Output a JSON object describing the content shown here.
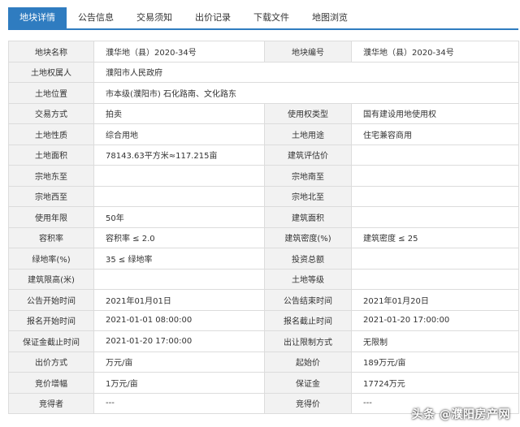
{
  "tabs": [
    {
      "label": "地块详情",
      "active": true
    },
    {
      "label": "公告信息"
    },
    {
      "label": "交易须知"
    },
    {
      "label": "出价记录"
    },
    {
      "label": "下载文件"
    },
    {
      "label": "地图浏览"
    }
  ],
  "rows": [
    [
      "地块名称",
      "濮华地（县）2020-34号",
      "地块编号",
      "濮华地（县）2020-34号"
    ],
    [
      "土地权属人",
      "濮阳市人民政府"
    ],
    [
      "土地位置",
      "市本级(濮阳市) 石化路南、文化路东"
    ],
    [
      "交易方式",
      "拍卖",
      "使用权类型",
      "国有建设用地使用权"
    ],
    [
      "土地性质",
      "综合用地",
      "土地用途",
      "住宅兼容商用"
    ],
    [
      "土地面积",
      "78143.63平方米≈117.215亩",
      "建筑评估价",
      ""
    ],
    [
      "宗地东至",
      "",
      "宗地南至",
      ""
    ],
    [
      "宗地西至",
      "",
      "宗地北至",
      ""
    ],
    [
      "使用年限",
      "50年",
      "建筑面积",
      ""
    ],
    [
      "容积率",
      "容积率 ≤ 2.0",
      "建筑密度(%)",
      "建筑密度 ≤ 25"
    ],
    [
      "绿地率(%)",
      "35 ≤ 绿地率",
      "投资总额",
      ""
    ],
    [
      "建筑限高(米)",
      "",
      "土地等级",
      ""
    ],
    [
      "公告开始时间",
      "2021年01月01日",
      "公告结束时间",
      "2021年01月20日"
    ],
    [
      "报名开始时间",
      "2021-01-01 08:00:00",
      "报名截止时间",
      "2021-01-20 17:00:00"
    ],
    [
      "保证金截止时间",
      "2021-01-20 17:00:00",
      "出让限制方式",
      "无限制"
    ],
    [
      "出价方式",
      "万元/亩",
      "起始价",
      "189万元/亩"
    ],
    [
      "竞价增幅",
      "1万元/亩",
      "保证金",
      "17724万元"
    ],
    [
      "竞得者",
      "---",
      "竞得价",
      "---"
    ]
  ],
  "watermark": "头条 @濮阳房产网",
  "colors": {
    "accent": "#2f7cc0",
    "label_bg": "#f2f2f2",
    "border": "#dcdcdc"
  }
}
